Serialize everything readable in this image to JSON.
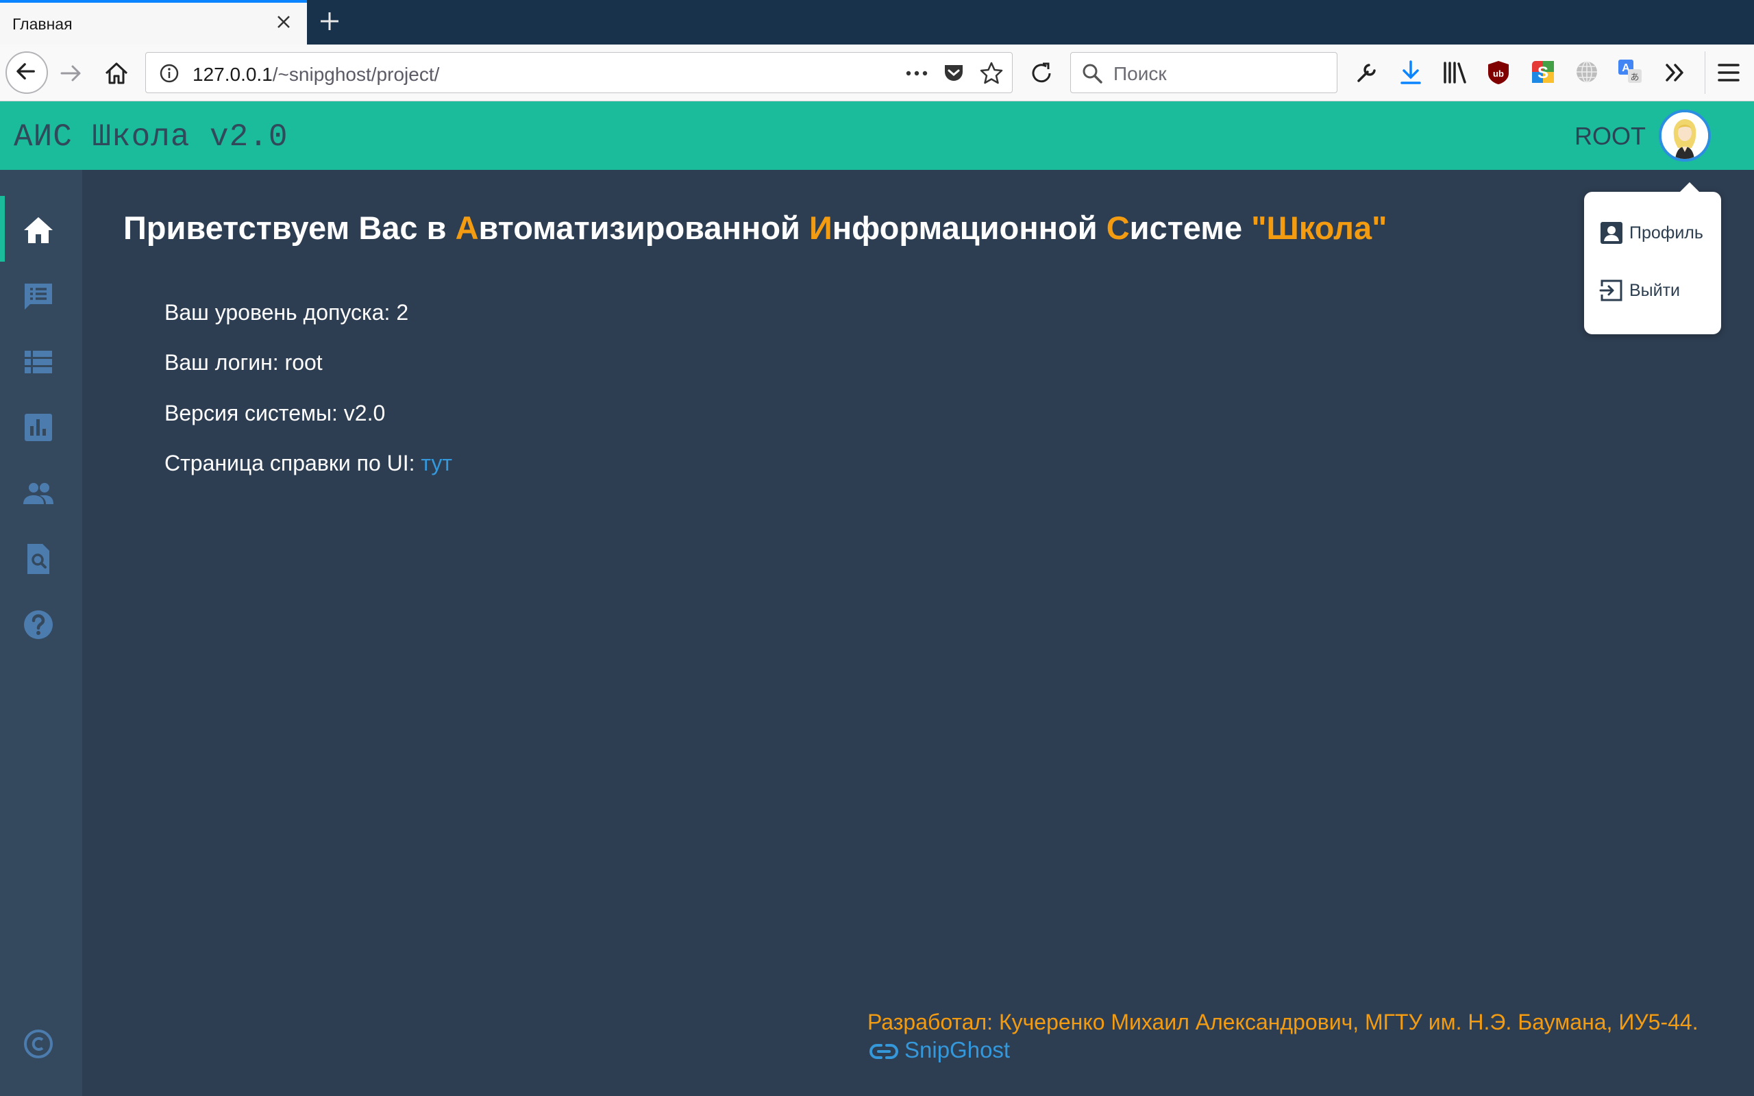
{
  "browser": {
    "tab_title": "Главная",
    "url_host": "127.0.0.1",
    "url_path": "/~snipghost/project/",
    "search_placeholder": "Поиск"
  },
  "header": {
    "title": "АИС Школа v2.0",
    "user": "ROOT"
  },
  "sidebar": {
    "items": [
      {
        "icon": "home-icon",
        "active": true
      },
      {
        "icon": "chat-list-icon",
        "active": false
      },
      {
        "icon": "list-icon",
        "active": false
      },
      {
        "icon": "bar-chart-icon",
        "active": false
      },
      {
        "icon": "people-icon",
        "active": false
      },
      {
        "icon": "search-document-icon",
        "active": false
      },
      {
        "icon": "help-icon",
        "active": false
      },
      {
        "icon": "copyright-icon",
        "active": false
      }
    ]
  },
  "main": {
    "welcome_1": "Приветствуем Вас в ",
    "welcome_a": "А",
    "welcome_2": "втоматизированной ",
    "welcome_i": "И",
    "welcome_3": "нформационной ",
    "welcome_s": "С",
    "welcome_4": "истеме ",
    "welcome_school": "\"Школа\"",
    "access_level": "Ваш уровень допуска: 2",
    "login": "Ваш логин: root",
    "version": "Версия системы: v2.0",
    "help_prefix": "Страница справки по UI: ",
    "help_link": "тут"
  },
  "footer": {
    "developer": "Разработал: Кучеренко Михаил Александрович, МГТУ им. Н.Э. Баумана, ИУ5-44.",
    "link": "SnipGhost"
  },
  "dropdown": {
    "profile": "Профиль",
    "logout": "Выйти"
  },
  "colors": {
    "accent": "#1abc9c",
    "highlight": "#f39c12",
    "link": "#3498db",
    "background": "#2e3e52",
    "sidebar": "#34495e"
  }
}
